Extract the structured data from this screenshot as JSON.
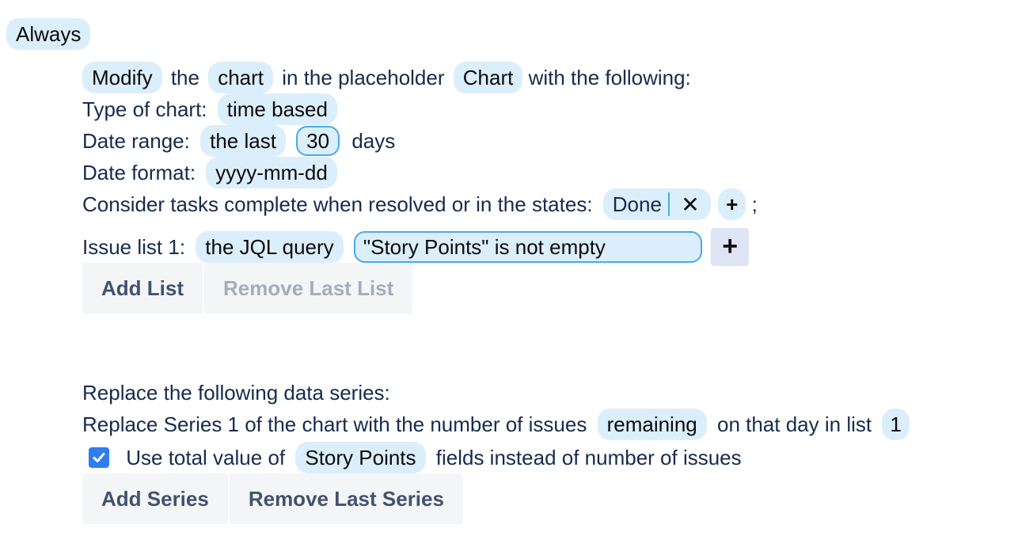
{
  "trigger": {
    "label": "Always"
  },
  "action": {
    "verb": "Modify",
    "text_the": "the",
    "object": "chart",
    "text_in_placeholder": "in the placeholder",
    "placeholder": "Chart",
    "text_with_following": "with the following:"
  },
  "chart_type": {
    "label": "Type of chart:",
    "value": "time based"
  },
  "date_range": {
    "label": "Date range:",
    "mode": "the last",
    "count": "30",
    "unit": "days"
  },
  "date_format": {
    "label": "Date format:",
    "value": "yyyy-mm-dd"
  },
  "complete_states": {
    "label": "Consider tasks complete when resolved or in the states:",
    "states": [
      {
        "label": "Done",
        "remove_icon": "close-icon"
      }
    ],
    "add_label": "+",
    "terminator": ";"
  },
  "issue_lists": [
    {
      "label": "Issue list 1:",
      "source": "the JQL query",
      "query": "\"Story Points\" is not empty",
      "add_label": "+"
    }
  ],
  "list_buttons": {
    "add": "Add List",
    "remove": "Remove Last List"
  },
  "series_section": {
    "heading": "Replace the following data series:",
    "series": [
      {
        "text_prefix": "Replace Series 1 of the chart with the number of issues",
        "state": "remaining",
        "text_mid": "on that day in list",
        "list_number": "1",
        "use_field_checked": true,
        "use_field_prefix": "Use total value of",
        "field": "Story Points",
        "use_field_suffix": "fields instead of number of issues"
      }
    ]
  },
  "series_buttons": {
    "add": "Add Series",
    "remove": "Remove Last Series"
  },
  "colors": {
    "pill_bg": "#dbeefb",
    "input_border": "#4aa9ea",
    "checkbox": "#2f7ef0",
    "text": "#172b4d",
    "button_bg": "#f4f5f7"
  }
}
